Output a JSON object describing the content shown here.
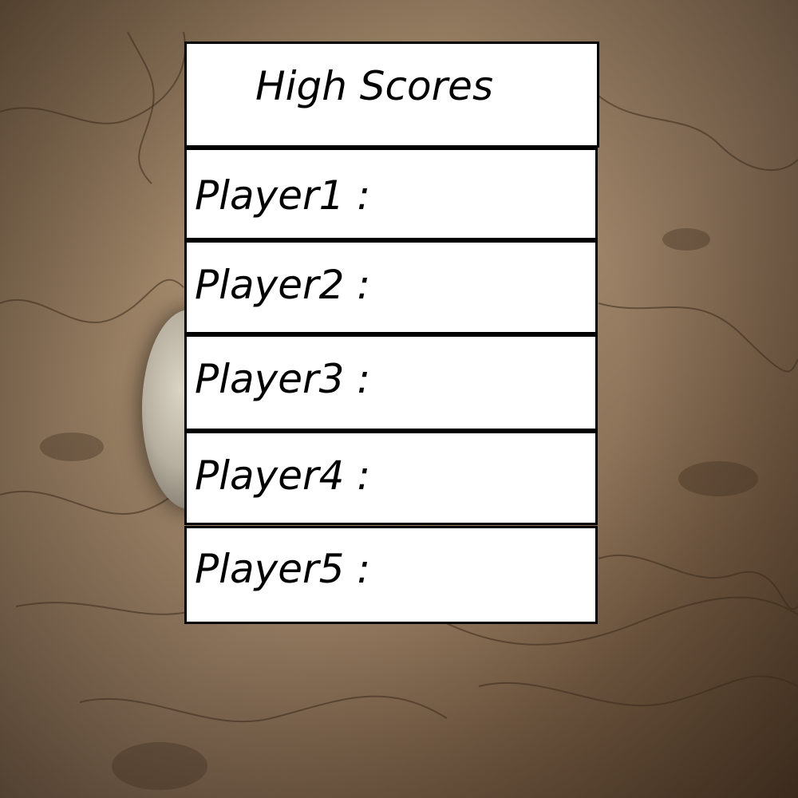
{
  "scoreboard": {
    "title": "High Scores",
    "rows": [
      {
        "label": "Player1 :"
      },
      {
        "label": "Player2 :"
      },
      {
        "label": "Player3 :"
      },
      {
        "label": "Player4 :"
      },
      {
        "label": "Player5 :"
      }
    ]
  },
  "background": {
    "description_icon": "old-map-background",
    "base_color": "#9b8166"
  }
}
